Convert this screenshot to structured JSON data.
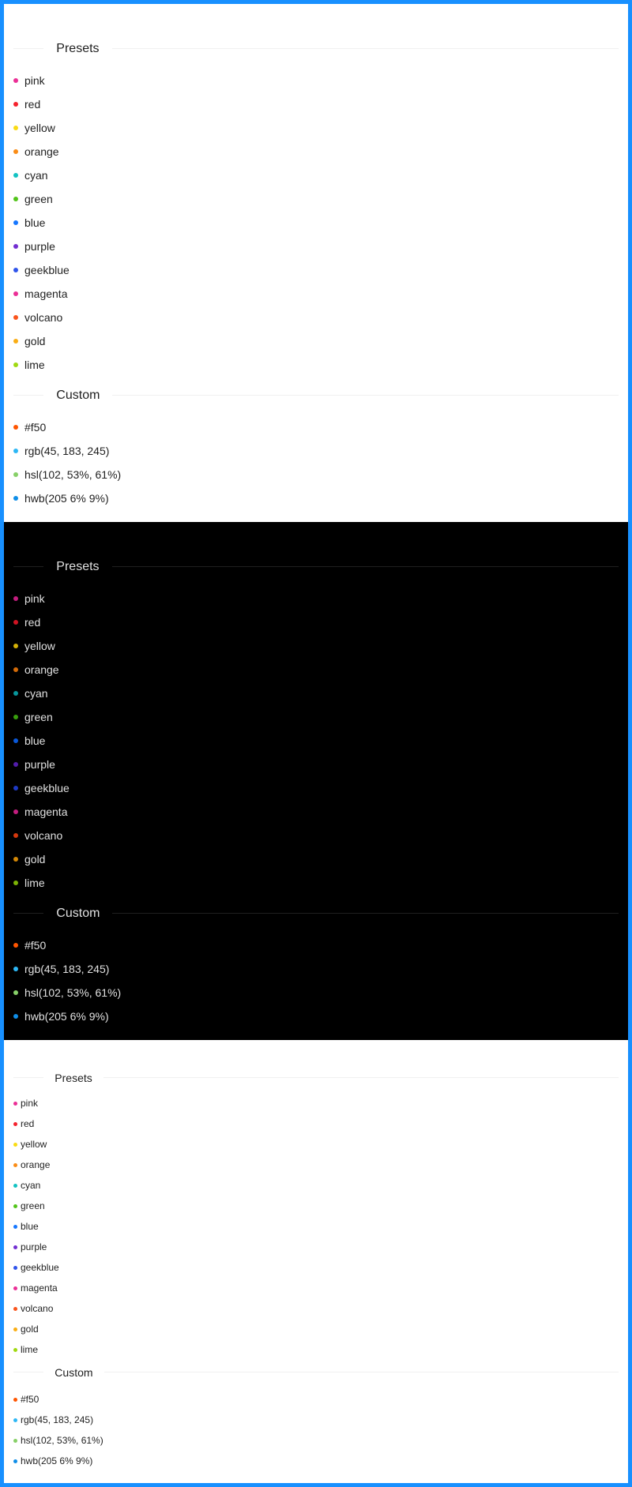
{
  "sections": {
    "presets_title": "Presets",
    "custom_title": "Custom"
  },
  "presets": [
    {
      "label": "pink",
      "color": "#eb2f96",
      "dark_color": "#c41d7f"
    },
    {
      "label": "red",
      "color": "#f5222d",
      "dark_color": "#cf1322"
    },
    {
      "label": "yellow",
      "color": "#fadb14",
      "dark_color": "#d4b106"
    },
    {
      "label": "orange",
      "color": "#fa8c16",
      "dark_color": "#d46b08"
    },
    {
      "label": "cyan",
      "color": "#13c2c2",
      "dark_color": "#08979c"
    },
    {
      "label": "green",
      "color": "#52c41a",
      "dark_color": "#389e0d"
    },
    {
      "label": "blue",
      "color": "#1677ff",
      "dark_color": "#0958d9"
    },
    {
      "label": "purple",
      "color": "#722ed1",
      "dark_color": "#531dab"
    },
    {
      "label": "geekblue",
      "color": "#2f54eb",
      "dark_color": "#1d39c4"
    },
    {
      "label": "magenta",
      "color": "#eb2f96",
      "dark_color": "#c41d7f"
    },
    {
      "label": "volcano",
      "color": "#fa541c",
      "dark_color": "#d4380d"
    },
    {
      "label": "gold",
      "color": "#faad14",
      "dark_color": "#d48806"
    },
    {
      "label": "lime",
      "color": "#a0d911",
      "dark_color": "#7cb305"
    }
  ],
  "custom": [
    {
      "label": "#f50",
      "color": "#ff5500"
    },
    {
      "label": "rgb(45, 183, 245)",
      "color": "#2db7f5"
    },
    {
      "label": "hsl(102, 53%, 61%)",
      "color": "#87d068"
    },
    {
      "label": "hwb(205 6% 9%)",
      "color": "#0f8ee8"
    }
  ]
}
